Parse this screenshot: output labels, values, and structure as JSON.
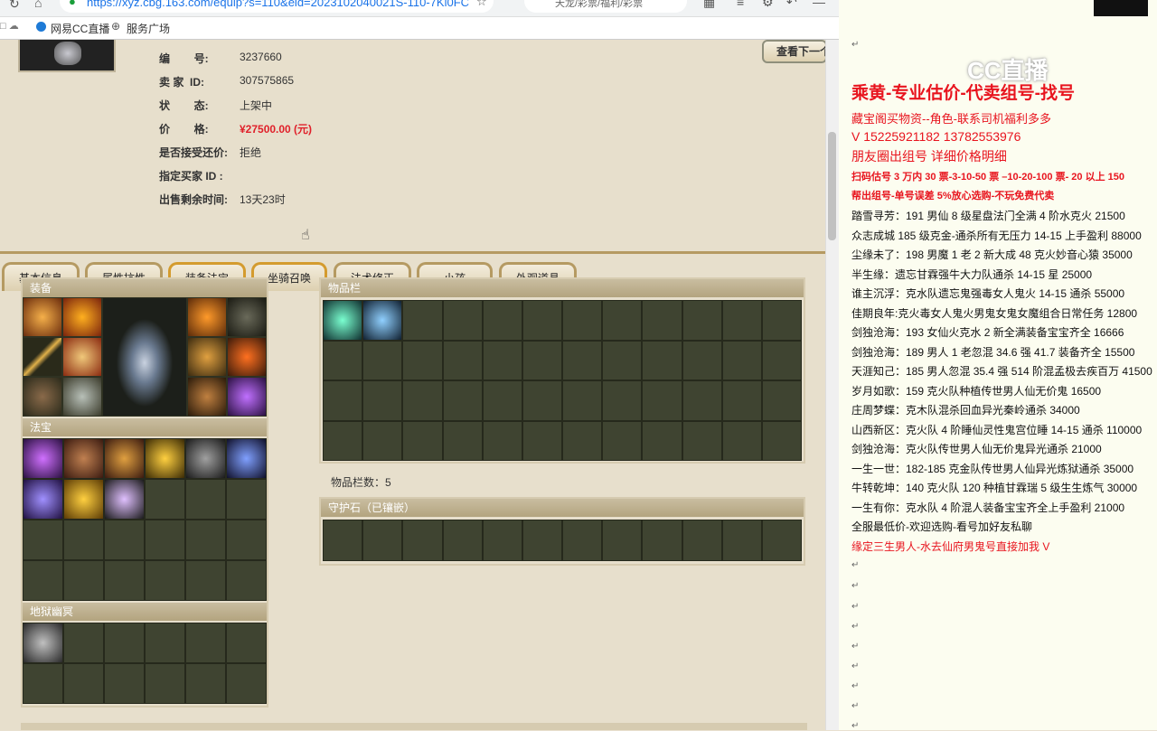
{
  "browser": {
    "url": "https://xyz.cbg.163.com/equip?s=110&eid=2023102040021S-110-7Ki0FC",
    "search_text": "天龙/彩票/福利/彩票",
    "bookmarks": [
      "网易CC直播",
      "服务广场"
    ]
  },
  "listing": {
    "next_button": "查看下一个",
    "labels": {
      "id": "编        号:",
      "seller": "卖 家  ID:",
      "status": "状        态:",
      "price": "价        格:",
      "bargain": "是否接受还价:",
      "buyer": "指定买家 ID :",
      "remain": "出售剩余时间:"
    },
    "id": "3237660",
    "seller": "307575865",
    "status": "上架中",
    "price": "¥27500.00 (元)",
    "bargain": "拒绝",
    "buyer": "",
    "remain": "13天23时"
  },
  "tabs": [
    "基本信息",
    "属性抗性",
    "装备法宝",
    "坐骑召唤",
    "法术修正",
    "小孩",
    "外观道具"
  ],
  "active_tab": "装备法宝",
  "panels": {
    "equip": "装备",
    "fabao": "法宝",
    "lingqi": "地狱幽冥",
    "items": "物品栏",
    "item_count": "物品栏数：5",
    "stone": "守护石（已镶嵌）"
  },
  "right_panel": {
    "watermark": "CC直播",
    "title": "乘黄-专业估价-代卖组号-找号",
    "lines_red": [
      "藏宝阁买物资--角色-联系司机福利多多",
      "V 15225921182    13782553976",
      "朋友圈出组号    详细价格明细"
    ],
    "bold_red": [
      "扫码估号 3 万内 30 票-3-10-50 票 –10-20-100 票- 20 以上 150",
      "帮出组号-单号误差 5%放心选购-不玩免费代卖"
    ],
    "listings": [
      "踏雪寻芳：191 男仙 8 级星盘法门全满 4 阶水克火 21500",
      "众志成城  185 级克金-通杀所有无压力 14-15 上手盈利 88000",
      "尘缘未了：198 男魔 1 老 2 新大成 48 克火妙音心猿 35000",
      "半生缘：遗忘甘霖强牛大力队通杀 14-15 星 25000",
      "谁主沉浮：克水队遗忘鬼强毒女人鬼火 14-15 通杀 55000",
      "佳期良年:克火毒女人鬼火男鬼女鬼女魔组合日常任务 12800",
      "剑独沧海：193 女仙火克水 2 新全满装备宝宝齐全 16666",
      "剑独沧海：189 男人 1 老忽混 34.6 强 41.7 装备齐全 15500",
      "天涯知己：185 男人忽混 35.4 强 514 阶混孟极去疾百万 41500",
      "岁月如歌：159 克火队种植传世男人仙无价鬼 16500",
      "庄周梦蝶：克木队混杀回血异光秦岭通杀 34000",
      "山西新区：克火队 4 阶睡仙灵性鬼宫位睡 14-15 通杀 110000",
      "剑独沧海：克火队传世男人仙无价鬼异光通杀 21000",
      "一生一世：182-185 克金队传世男人仙异光炼狱通杀 35000",
      "牛转乾坤：140 克火队 120 种植甘霖瑞 5 级生生炼气 30000",
      "一生有你：克水队 4 阶混人装备宝宝齐全上手盈利 21000"
    ],
    "footer_black": "全服最低价-欢迎选购-看号加好友私聊",
    "footer_red": "缘定三生男人-水去仙府男鬼号直接加我 V"
  }
}
